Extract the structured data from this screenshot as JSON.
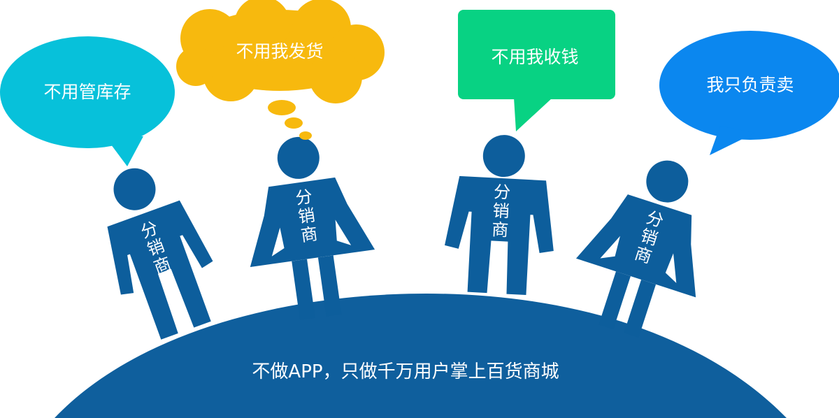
{
  "colors": {
    "figure_blue": "#0d5e9c",
    "planet_blue": "#0f5f9d",
    "bubble_cyan": "#07c1da",
    "bubble_yellow": "#f7b90e",
    "bubble_green": "#08d283",
    "bubble_blue": "#0b87ef"
  },
  "bubbles": [
    {
      "text": "不用管库存",
      "color_key": "bubble_cyan",
      "shape": "speech-ellipse"
    },
    {
      "text": "不用我发货",
      "color_key": "bubble_yellow",
      "shape": "thought-cloud"
    },
    {
      "text": "不用我收钱",
      "color_key": "bubble_green",
      "shape": "speech-rectangle"
    },
    {
      "text": "我只负责卖",
      "color_key": "bubble_blue",
      "shape": "speech-ellipse"
    }
  ],
  "figures": [
    {
      "label_lines": [
        "分",
        "销",
        "商"
      ],
      "gender": "male"
    },
    {
      "label_lines": [
        "分",
        "销",
        "商"
      ],
      "gender": "female"
    },
    {
      "label_lines": [
        "分",
        "销",
        "商"
      ],
      "gender": "male"
    },
    {
      "label_lines": [
        "分",
        "销",
        "商"
      ],
      "gender": "female"
    }
  ],
  "planet": {
    "caption": "不做APP，只做千万用户掌上百货商城"
  }
}
